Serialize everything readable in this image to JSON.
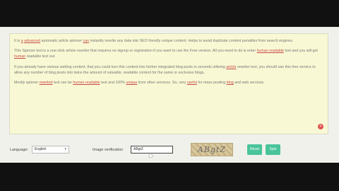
{
  "editor": {
    "paragraphs": [
      [
        {
          "t": "It is "
        },
        {
          "t": "a",
          "u": 1
        },
        {
          "t": " "
        },
        {
          "t": "advanced",
          "u": 1
        },
        {
          "t": " automatic article spinner "
        },
        {
          "t": "can",
          "u": 1
        },
        {
          "t": " instantly rewrite any data into SEO friendly unique content. Helps to avoid duplicate content penalties from search engines."
        }
      ],
      [
        {
          "t": "This Spinner tool is a one-click article rewriter that requires no signup or registration if you want to use the Free version. All you need to do is enter "
        },
        {
          "t": "human readable",
          "u": 1
        },
        {
          "t": " text and you will get "
        },
        {
          "t": "human",
          "u": 1
        },
        {
          "t": " readable text out."
        }
      ],
      [
        {
          "t": "If you already have various weblog content, that you could turn this content into further integrated blog posts in seconds utilizing "
        },
        {
          "t": "article",
          "u": 1
        },
        {
          "t": " rewriter tool, you should use this free service to allow any number of blog posts into twice the amount of valuable, readable content for the same or exclusive blogs."
        }
      ],
      [
        {
          "t": "Mostly spinner "
        },
        {
          "t": "rewrited",
          "u": 1
        },
        {
          "t": " text can be "
        },
        {
          "t": "human readable",
          "u": 1
        },
        {
          "t": " text and 100% "
        },
        {
          "t": "unique",
          "u": 1
        },
        {
          "t": " from other services. So, very "
        },
        {
          "t": "useful",
          "u": 1
        },
        {
          "t": " for mass posting "
        },
        {
          "t": "blog",
          "u": 1
        },
        {
          "t": " and web services."
        }
      ]
    ],
    "close_glyph": "×"
  },
  "controls": {
    "language_label": "Language:",
    "language_value": "English",
    "language_caret": "▾",
    "verification_label": "Image verification",
    "verification_value": "ABgtZ",
    "captcha_text": "ABgtZ",
    "reset_label": "Reset",
    "spin_label": "Spin"
  },
  "colors": {
    "editor_bg": "#f8f9d4",
    "button_bg": "#49c49a",
    "page_bg": "#f1f1ec",
    "frame_bg": "#111111"
  }
}
